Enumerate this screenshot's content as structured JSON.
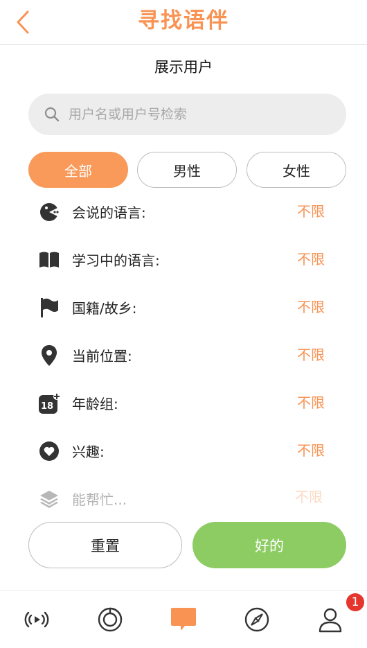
{
  "header": {
    "title": "寻找语伴",
    "back_icon": "chevron-left-icon"
  },
  "section": {
    "title": "展示用户"
  },
  "search": {
    "placeholder": "用户名或用户号检索",
    "value": ""
  },
  "gender_filter": {
    "options": [
      "全部",
      "男性",
      "女性"
    ],
    "selected": "全部"
  },
  "filters": [
    {
      "icon": "language-speak-icon",
      "label": "会说的语言:",
      "value": "不限"
    },
    {
      "icon": "book-icon",
      "label": "学习中的语言:",
      "value": "不限"
    },
    {
      "icon": "flag-icon",
      "label": "国籍/故乡:",
      "value": "不限"
    },
    {
      "icon": "location-pin-icon",
      "label": "当前位置:",
      "value": "不限"
    },
    {
      "icon": "age-18-plus-icon",
      "label": "年龄组:",
      "value": "不限"
    },
    {
      "icon": "heart-icon",
      "label": "兴趣:",
      "value": "不限"
    },
    {
      "icon": "layers-icon",
      "label": "能帮忙...",
      "value": "不限"
    }
  ],
  "actions": {
    "reset_label": "重置",
    "ok_label": "好的"
  },
  "tabbar": {
    "items": [
      "live-broadcast-icon",
      "moments-icon",
      "chat-icon",
      "compass-icon",
      "profile-icon"
    ],
    "active": "chat-icon",
    "badge": "1"
  },
  "colors": {
    "accent": "#f99353",
    "ok": "#8ccc63",
    "badge": "#e5362d"
  }
}
